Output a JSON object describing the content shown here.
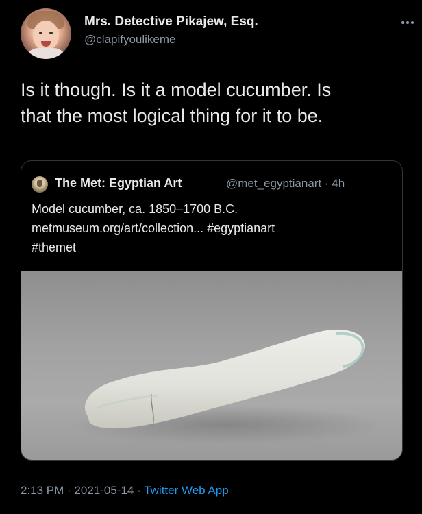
{
  "author": {
    "name": "Mrs. Detective Pikajew, Esq.",
    "handle": "@clapifyoulikeme",
    "avatar_icon": "profile-photo-toddler"
  },
  "tweet": {
    "line1": "Is it though. Is it a model cucumber. Is",
    "line2": "that the most logical thing for it to be."
  },
  "quoted": {
    "name": "The Met: Egyptian Art",
    "handle_time": "@met_egyptianart · 4h",
    "line1": "Model cucumber, ca. 1850–1700 B.C.",
    "line2": "metmuseum.org/art/collection... #egyptianart",
    "line3": "#themet",
    "avatar_icon": "met-egyptian-bust-avatar",
    "image": "photo-white-ceramic-cucumber"
  },
  "meta": {
    "time": "2:13 PM",
    "sep1": " · ",
    "date": "2021-05-14",
    "sep2": " · ",
    "app": "Twitter Web App"
  },
  "colors": {
    "background": "#000000",
    "text": "#e7e9ea",
    "secondary": "#8b98a5",
    "link": "#1d9bf0",
    "border": "#333639"
  }
}
